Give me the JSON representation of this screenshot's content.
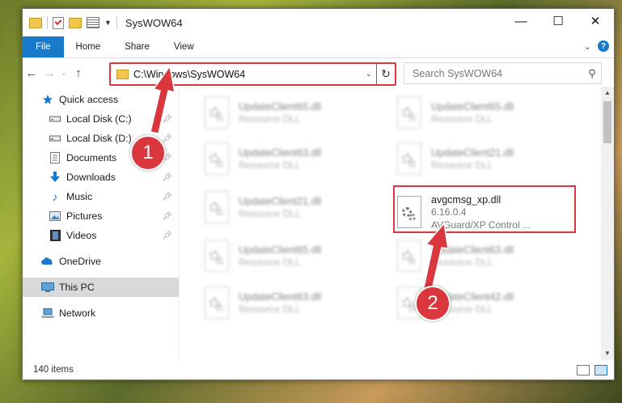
{
  "window": {
    "title": "SysWOW64"
  },
  "ribbon": {
    "tabs": [
      "File",
      "Home",
      "Share",
      "View"
    ]
  },
  "nav": {
    "address": "C:\\Windows\\SysWOW64",
    "search_placeholder": "Search SysWOW64"
  },
  "sidebar": {
    "items": [
      {
        "label": "Quick access",
        "icon": "star-icon",
        "pinned": false
      },
      {
        "label": "Local Disk (C:)",
        "icon": "drive-icon",
        "pinned": true
      },
      {
        "label": "Local Disk (D:)",
        "icon": "drive-icon",
        "pinned": true
      },
      {
        "label": "Documents",
        "icon": "documents-icon",
        "pinned": true
      },
      {
        "label": "Downloads",
        "icon": "download-icon",
        "pinned": true
      },
      {
        "label": "Music",
        "icon": "music-icon",
        "pinned": true
      },
      {
        "label": "Pictures",
        "icon": "pictures-icon",
        "pinned": true
      },
      {
        "label": "Videos",
        "icon": "videos-icon",
        "pinned": true
      },
      {
        "label": "OneDrive",
        "icon": "cloud-icon",
        "pinned": false
      },
      {
        "label": "This PC",
        "icon": "computer-icon",
        "pinned": false
      },
      {
        "label": "Network",
        "icon": "network-icon",
        "pinned": false
      }
    ]
  },
  "files": [
    {
      "name": "UpdateClient65.dll",
      "line2": "Resource DLL"
    },
    {
      "name": "UpdateClient65.dll",
      "line2": "Resource DLL"
    },
    {
      "name": "UpdateClient63.dll",
      "line2": "Resource DLL"
    },
    {
      "name": "UpdateClient21.dll",
      "line2": "Resource DLL"
    },
    {
      "name": "UpdateClient21.dll",
      "line2": "Resource DLL"
    },
    {
      "name": "avgcmsg_xp.dll",
      "line2": "6.16.0.4",
      "line3": "AVGuard/XP Control ..."
    },
    {
      "name": "UpdateClient65.dll",
      "line2": "Resource DLL"
    },
    {
      "name": "UpdateClient63.dll",
      "line2": "Resource DLL"
    },
    {
      "name": "UpdateClient63.dll",
      "line2": "Resource DLL"
    },
    {
      "name": "UpdateClient42.dll",
      "line2": "Resource DLL"
    }
  ],
  "status": {
    "item_count": "140 items"
  },
  "annotations": {
    "step1": "1",
    "step2": "2"
  },
  "colors": {
    "accent": "#1979ca",
    "highlight": "#d9363e"
  }
}
